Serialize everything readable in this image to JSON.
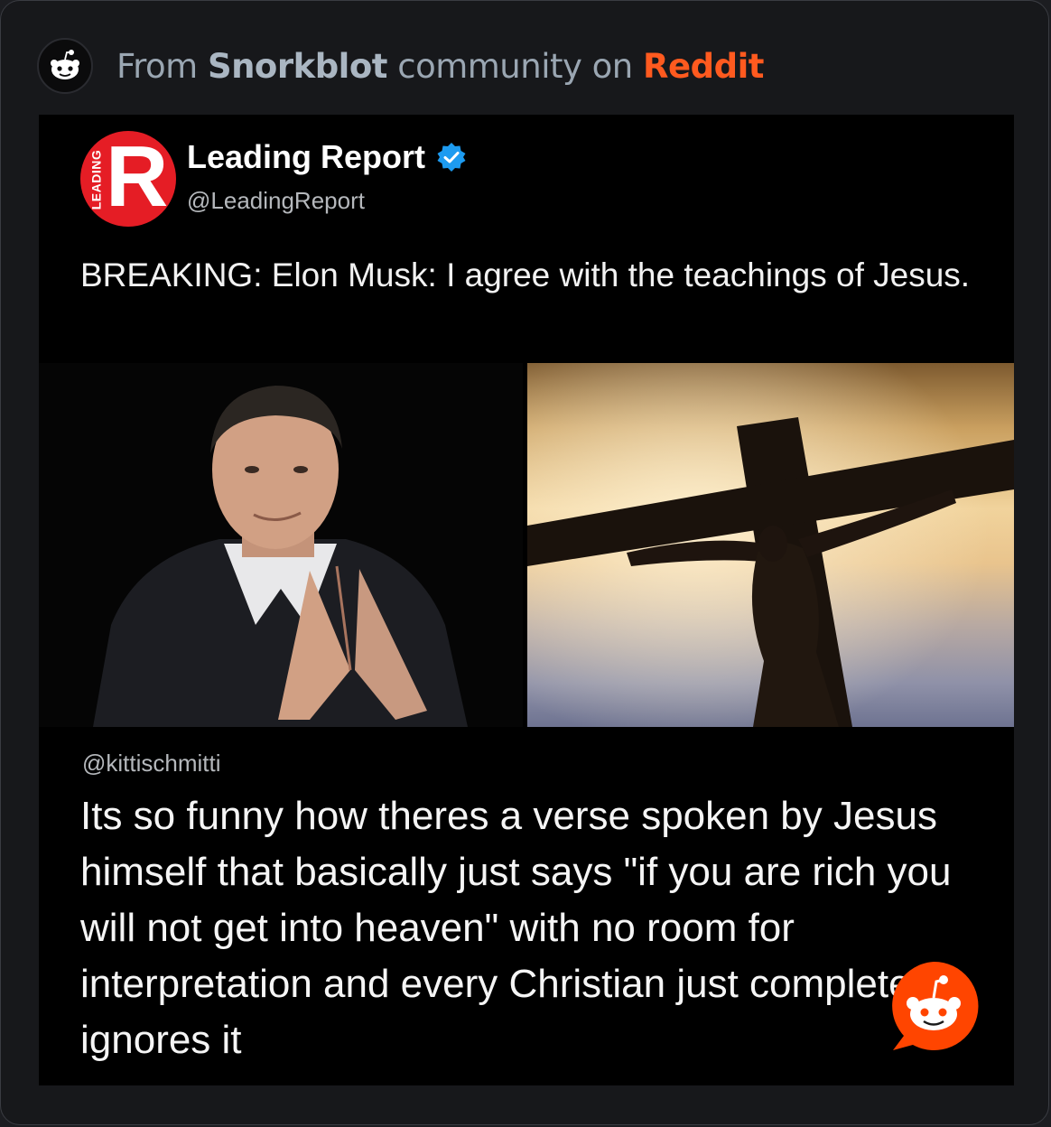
{
  "header": {
    "prefix": "From ",
    "community": "Snorkblot",
    "middle": " community on ",
    "platform": "Reddit",
    "reddit_color": "#ff5a1f"
  },
  "tweet": {
    "name": "Leading Report",
    "handle": "@LeadingReport",
    "logo_letter": "R",
    "logo_vertical_text": "LEADING",
    "text": "BREAKING: Elon Musk: I agree with the teachings of Jesus.",
    "logo_color": "#e51d25"
  },
  "images": {
    "left_icon": "portrait-photo",
    "right_icon": "crucifix-silhouette-photo"
  },
  "reply": {
    "handle": "@kittischmitti",
    "text": "Its so funny how theres a verse spoken by Jesus himself that basically just says \"if you are rich you will not get into heaven\" with no room for interpretation and every Christian just completely ignores it"
  },
  "icons": {
    "header_avatar": "reddit-snoo-icon",
    "verified": "verified-badge-icon",
    "watermark": "reddit-snoo-bubble-icon"
  }
}
